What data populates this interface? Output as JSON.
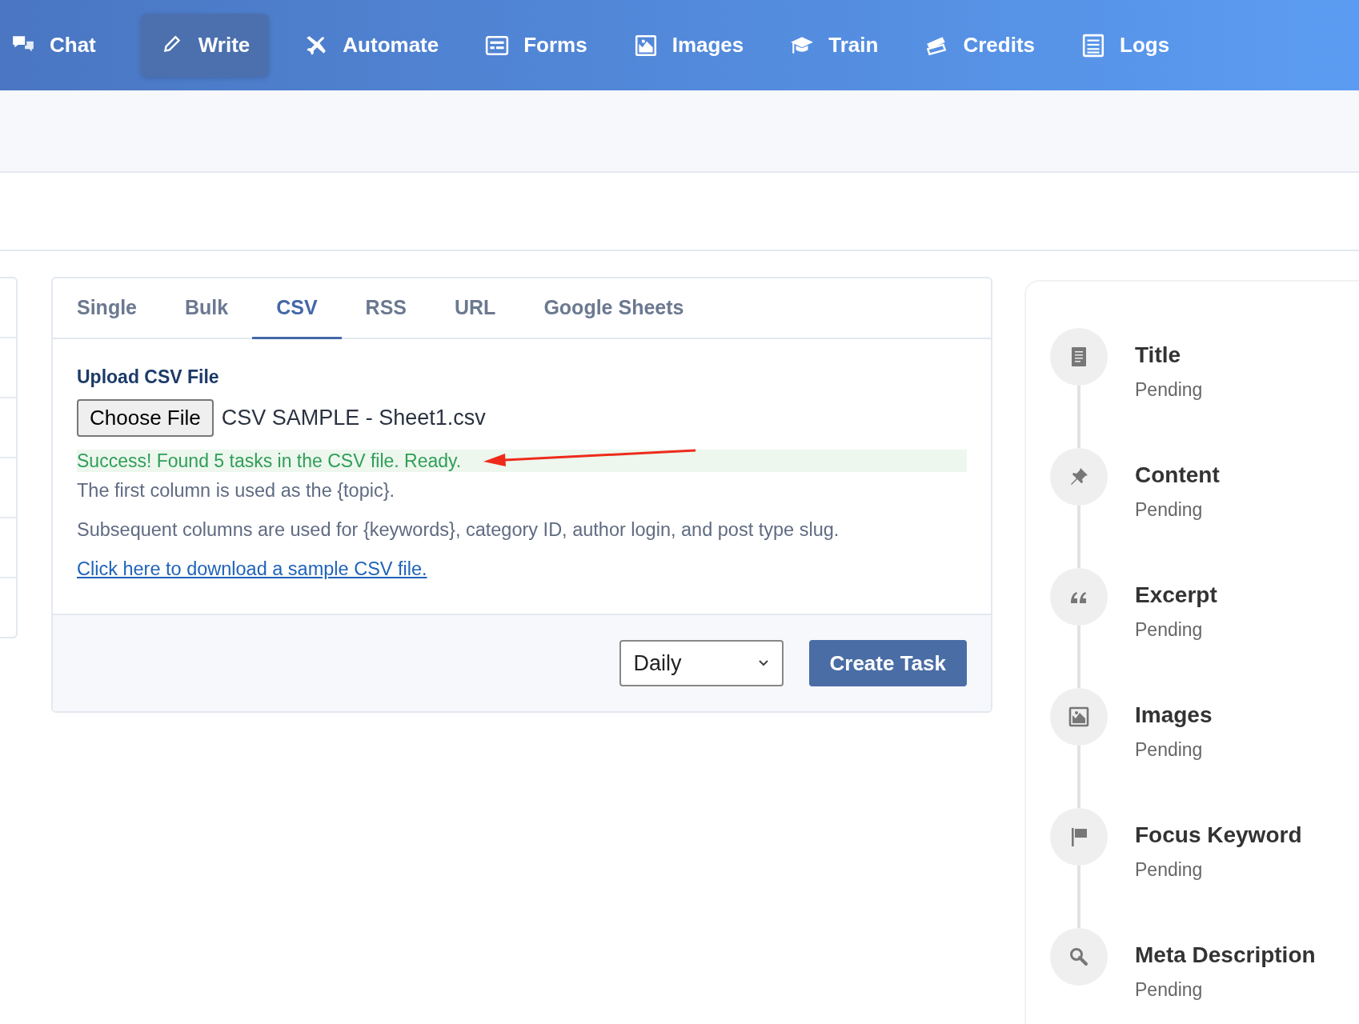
{
  "nav": [
    {
      "label": "Chat",
      "kind": "chat",
      "selected": false
    },
    {
      "label": "Write",
      "kind": "pencil",
      "selected": true
    },
    {
      "label": "Automate",
      "kind": "plane",
      "selected": false
    },
    {
      "label": "Forms",
      "kind": "form",
      "selected": false
    },
    {
      "label": "Images",
      "kind": "image",
      "selected": false
    },
    {
      "label": "Train",
      "kind": "cap",
      "selected": false
    },
    {
      "label": "Credits",
      "kind": "tickets",
      "selected": false
    },
    {
      "label": "Logs",
      "kind": "list",
      "selected": false
    }
  ],
  "tabs": [
    {
      "label": "Single",
      "selected": false
    },
    {
      "label": "Bulk",
      "selected": false
    },
    {
      "label": "CSV",
      "selected": true
    },
    {
      "label": "RSS",
      "selected": false
    },
    {
      "label": "URL",
      "selected": false
    },
    {
      "label": "Google Sheets",
      "selected": false
    }
  ],
  "upload": {
    "label": "Upload CSV File",
    "button": "Choose File",
    "file_name": "CSV SAMPLE - Sheet1.csv"
  },
  "success_message": "Success! Found 5 tasks in the CSV file. Ready.",
  "notes": [
    "The first column is used as the {topic}.",
    "Subsequent columns are used for {keywords}, category ID, author login, and post type slug."
  ],
  "sample_link": "Click here to download a sample CSV file.",
  "schedule_select": {
    "value": "Daily"
  },
  "create_button": "Create Task",
  "steps": [
    {
      "title": "Title",
      "status": "Pending",
      "kind": "document"
    },
    {
      "title": "Content",
      "status": "Pending",
      "kind": "pin"
    },
    {
      "title": "Excerpt",
      "status": "Pending",
      "kind": "quote"
    },
    {
      "title": "Images",
      "status": "Pending",
      "kind": "image"
    },
    {
      "title": "Focus Keyword",
      "status": "Pending",
      "kind": "flag"
    },
    {
      "title": "Meta Description",
      "status": "Pending",
      "kind": "search"
    }
  ]
}
